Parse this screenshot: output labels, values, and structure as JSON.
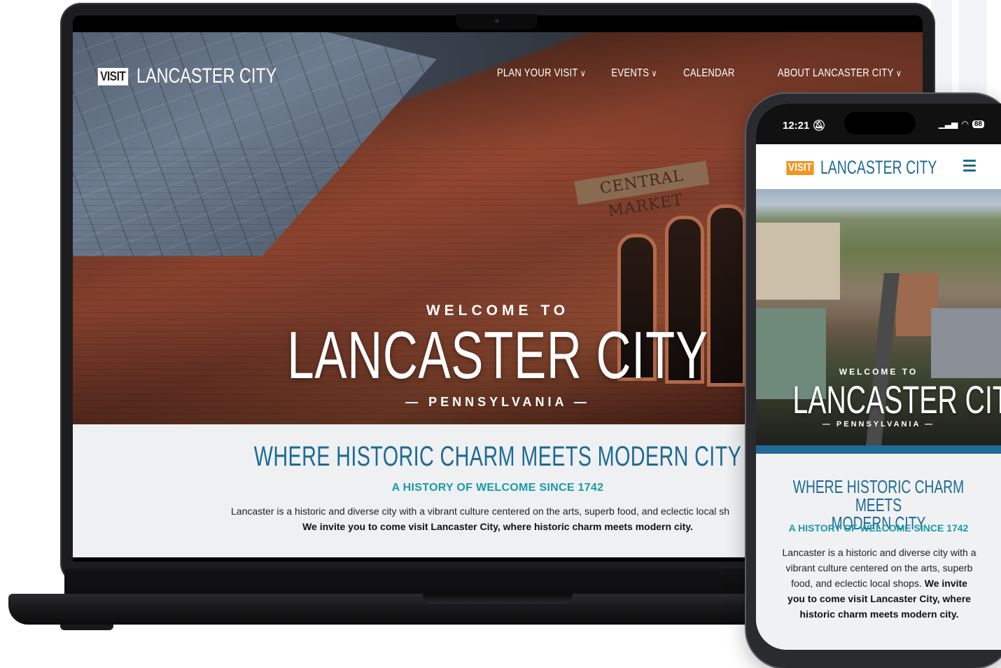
{
  "desktop": {
    "logo": {
      "badge": "VISIT",
      "name": "LANCASTER CITY"
    },
    "nav": [
      {
        "label": "PLAN YOUR VISIT",
        "has_dropdown": true
      },
      {
        "label": "EVENTS",
        "has_dropdown": true
      },
      {
        "label": "CALENDAR",
        "has_dropdown": false
      },
      {
        "label": "ABOUT LANCASTER CITY",
        "has_dropdown": true
      }
    ],
    "hero": {
      "welcome": "WELCOME TO",
      "title": "LANCASTER CITY",
      "state": "— PENNSYLVANIA —",
      "sign": "CENTRAL MARKET"
    },
    "content": {
      "headline": "WHERE HISTORIC CHARM MEETS MODERN CITY",
      "subheadline": "A HISTORY OF WELCOME SINCE 1742",
      "body": "Lancaster is a historic and diverse city with a vibrant culture centered on the arts, superb food, and eclectic local sh",
      "body_bold": "We invite you to come visit Lancaster City, where historic charm meets modern city."
    }
  },
  "mobile": {
    "status": {
      "time": "12:21",
      "battery": "88"
    },
    "logo": {
      "badge": "VISIT",
      "name": "LANCASTER CITY"
    },
    "hero": {
      "welcome": "WELCOME TO",
      "title": "LANCASTER CITY",
      "state": "— PENNSYLVANIA —"
    },
    "content": {
      "headline_line1": "WHERE HISTORIC CHARM MEETS",
      "headline_line2": "MODERN CITY",
      "subheadline": "A HISTORY OF WELCOME SINCE 1742",
      "body": "Lancaster is a historic and diverse city with a vibrant culture centered on the arts, superb food, and eclectic local shops.",
      "body_bold": "We invite you to come visit Lancaster City, where historic charm meets modern city."
    }
  },
  "colors": {
    "brand_blue": "#1e6a94",
    "accent_teal": "#1a9aa8",
    "logo_orange": "#f2941f",
    "bar_blue": "#1f6b96"
  }
}
